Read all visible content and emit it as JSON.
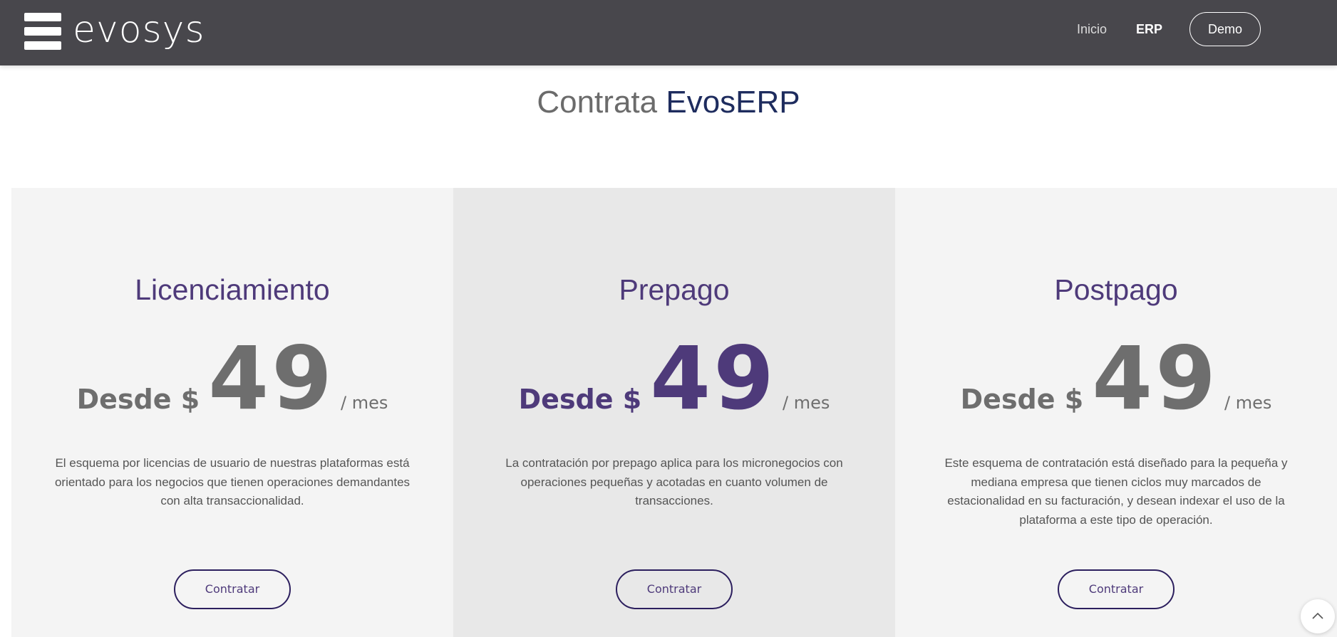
{
  "header": {
    "logo_text": "evosys",
    "logo_icon": "stacked-bars-icon",
    "nav": [
      {
        "label": "Inicio",
        "active": false
      },
      {
        "label": "ERP",
        "active": true
      }
    ],
    "demo_label": "Demo"
  },
  "main": {
    "title_prefix": "Contrata",
    "title_accent": "EvosERP",
    "accent_color": "#4e3a7a"
  },
  "plans": [
    {
      "name": "Licenciamiento",
      "price_prefix": "Desde $",
      "price": "49",
      "price_unit": "/ mes",
      "description": "El esquema por licencias de usuario de nuestras plataformas está orientado para los negocios que tienen operaciones demandantes con alta transaccionalidad.",
      "button_label": "Contratar"
    },
    {
      "name": "Prepago",
      "price_prefix": "Desde $",
      "price": "49",
      "price_unit": "/ mes",
      "description": "La contratación por prepago aplica para los micronegocios con operaciones pequeñas y acotadas en cuanto volumen de transacciones.",
      "button_label": "Contratar",
      "featured": true
    },
    {
      "name": "Postpago",
      "price_prefix": "Desde $",
      "price": "49",
      "price_unit": "/ mes",
      "description": "Este esquema de contratación está diseñado para la pequeña y mediana empresa que tienen ciclos muy marcados de estacionalidad en su facturación, y desean indexar el uso de la plataforma a este tipo de operación.",
      "button_label": "Contratar"
    }
  ],
  "scroll_top_icon": "chevron-up-icon"
}
